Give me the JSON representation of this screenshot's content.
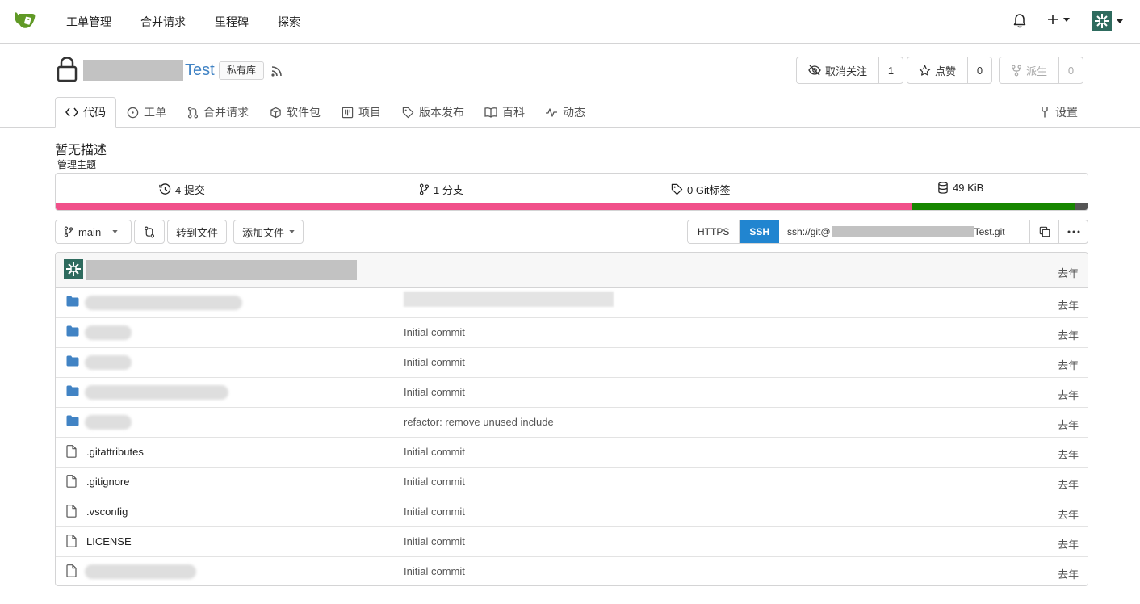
{
  "nav": {
    "items": [
      "工单管理",
      "合并请求",
      "里程碑",
      "探索"
    ],
    "plus": "+"
  },
  "repo": {
    "name": "Test",
    "badge": "私有库",
    "watch_label": "取消关注",
    "watch_count": "1",
    "star_label": "点赞",
    "star_count": "0",
    "fork_label": "派生",
    "fork_count": "0"
  },
  "tabs": [
    {
      "label": "代码",
      "icon": "code-icon"
    },
    {
      "label": "工单",
      "icon": "issue-icon"
    },
    {
      "label": "合并请求",
      "icon": "pull-request-icon"
    },
    {
      "label": "软件包",
      "icon": "package-icon"
    },
    {
      "label": "项目",
      "icon": "project-icon"
    },
    {
      "label": "版本发布",
      "icon": "tag-icon"
    },
    {
      "label": "百科",
      "icon": "book-icon"
    },
    {
      "label": "动态",
      "icon": "pulse-icon"
    },
    {
      "label": "设置",
      "icon": "tools-icon"
    }
  ],
  "description": "暂无描述",
  "manage_topics": "管理主题",
  "stats": {
    "commits": "4 提交",
    "branches": "1 分支",
    "tags": "0 Git标签",
    "size": "49 KiB"
  },
  "languages": [
    {
      "share": 0.83,
      "color": "#f1508a"
    },
    {
      "share": 0.158,
      "color": "#178600"
    },
    {
      "share": 0.012,
      "color": "#555555"
    }
  ],
  "toolbar": {
    "branch": "main",
    "go_to_file": "转到文件",
    "add_file": "添加文件"
  },
  "clone": {
    "https": "HTTPS",
    "ssh": "SSH",
    "url_prefix": "ssh://git@",
    "url_suffix": "Test.git"
  },
  "latest_commit": {
    "time": "去年"
  },
  "files": [
    {
      "type": "dir",
      "name": "",
      "message": "",
      "time": "去年"
    },
    {
      "type": "dir",
      "name": "",
      "message": "Initial commit",
      "time": "去年"
    },
    {
      "type": "dir",
      "name": "",
      "message": "Initial commit",
      "time": "去年"
    },
    {
      "type": "dir",
      "name": "",
      "message": "Initial commit",
      "time": "去年"
    },
    {
      "type": "dir",
      "name": "",
      "message": "refactor: remove unused include",
      "time": "去年"
    },
    {
      "type": "file",
      "name": ".gitattributes",
      "message": "Initial commit",
      "time": "去年"
    },
    {
      "type": "file",
      "name": ".gitignore",
      "message": "Initial commit",
      "time": "去年"
    },
    {
      "type": "file",
      "name": ".vsconfig",
      "message": "Initial commit",
      "time": "去年"
    },
    {
      "type": "file",
      "name": "LICENSE",
      "message": "Initial commit",
      "time": "去年"
    },
    {
      "type": "file",
      "name": "",
      "message": "Initial commit",
      "time": "去年"
    }
  ]
}
